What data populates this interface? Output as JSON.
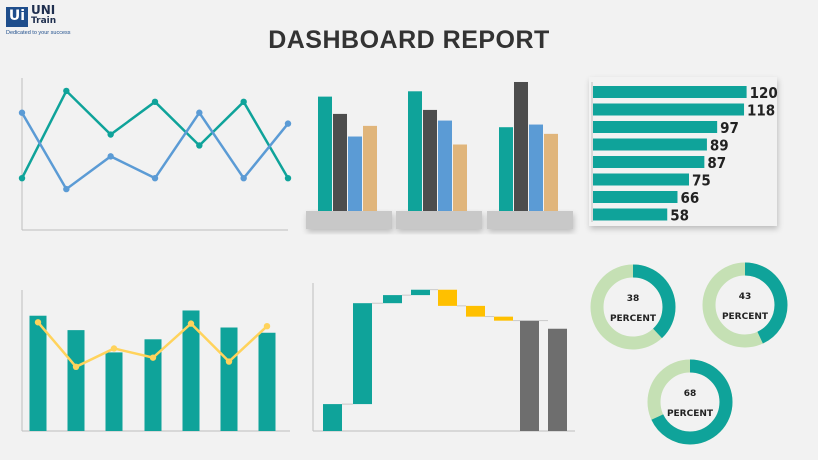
{
  "logo": {
    "mark": "Ui",
    "name_line1": "UNI",
    "name_line2": "Train",
    "tagline": "Dedicated to your success"
  },
  "title": "DASHBOARD REPORT",
  "colors": {
    "teal": "#0fa39a",
    "blue": "#5b9bd5",
    "dark": "#4d4d4d",
    "tan": "#e0b57b",
    "yellow": "#ffd35c",
    "orange": "#ffc000",
    "gray": "#6e6e6e",
    "donut_bg": "#c5e0b4",
    "bg": "#f2f2f2"
  },
  "chart_data": [
    {
      "type": "line",
      "series": [
        {
          "values": [
            2,
            10,
            6,
            9,
            5,
            9,
            2
          ]
        },
        {
          "values": [
            8,
            1,
            4,
            2,
            8,
            2,
            7
          ]
        }
      ],
      "ylim": [
        0,
        11
      ]
    },
    {
      "type": "bar",
      "categories": [
        "",
        "",
        ""
      ],
      "series": [
        {
          "values": [
            86,
            90,
            63
          ]
        },
        {
          "values": [
            73,
            76,
            97
          ]
        },
        {
          "values": [
            56,
            68,
            65
          ]
        },
        {
          "values": [
            64,
            50,
            58
          ]
        }
      ],
      "ylim": [
        0,
        100
      ]
    },
    {
      "type": "bar",
      "orientation": "horizontal",
      "values": [
        120,
        118,
        97,
        89,
        87,
        75,
        66,
        58
      ],
      "xlim": [
        0,
        125
      ]
    },
    {
      "type": "bar",
      "series": [
        {
          "values": [
            88,
            77,
            60,
            70,
            92,
            79,
            75
          ]
        },
        {
          "values": [
            83,
            49,
            63,
            56,
            82,
            53,
            80
          ]
        }
      ],
      "ylim": [
        0,
        100
      ]
    },
    {
      "type": "bar",
      "subtype": "waterfall",
      "steps": [
        {
          "kind": "total",
          "value": 20
        },
        {
          "kind": "delta",
          "value": 75
        },
        {
          "kind": "delta",
          "value": 6
        },
        {
          "kind": "delta",
          "value": 4
        },
        {
          "kind": "delta",
          "value": -12
        },
        {
          "kind": "delta",
          "value": -8
        },
        {
          "kind": "delta",
          "value": -3
        },
        {
          "kind": "total",
          "value": 82
        },
        {
          "kind": "total",
          "value": 76
        }
      ],
      "ylim": [
        0,
        110
      ]
    },
    {
      "type": "pie",
      "subtype": "donut",
      "donuts": [
        {
          "value": 38,
          "number_label": "38",
          "unit_label": "PERCENT"
        },
        {
          "value": 43,
          "number_label": "43",
          "unit_label": "PERCENT"
        },
        {
          "value": 68,
          "number_label": "68",
          "unit_label": "PERCENT"
        }
      ]
    }
  ]
}
